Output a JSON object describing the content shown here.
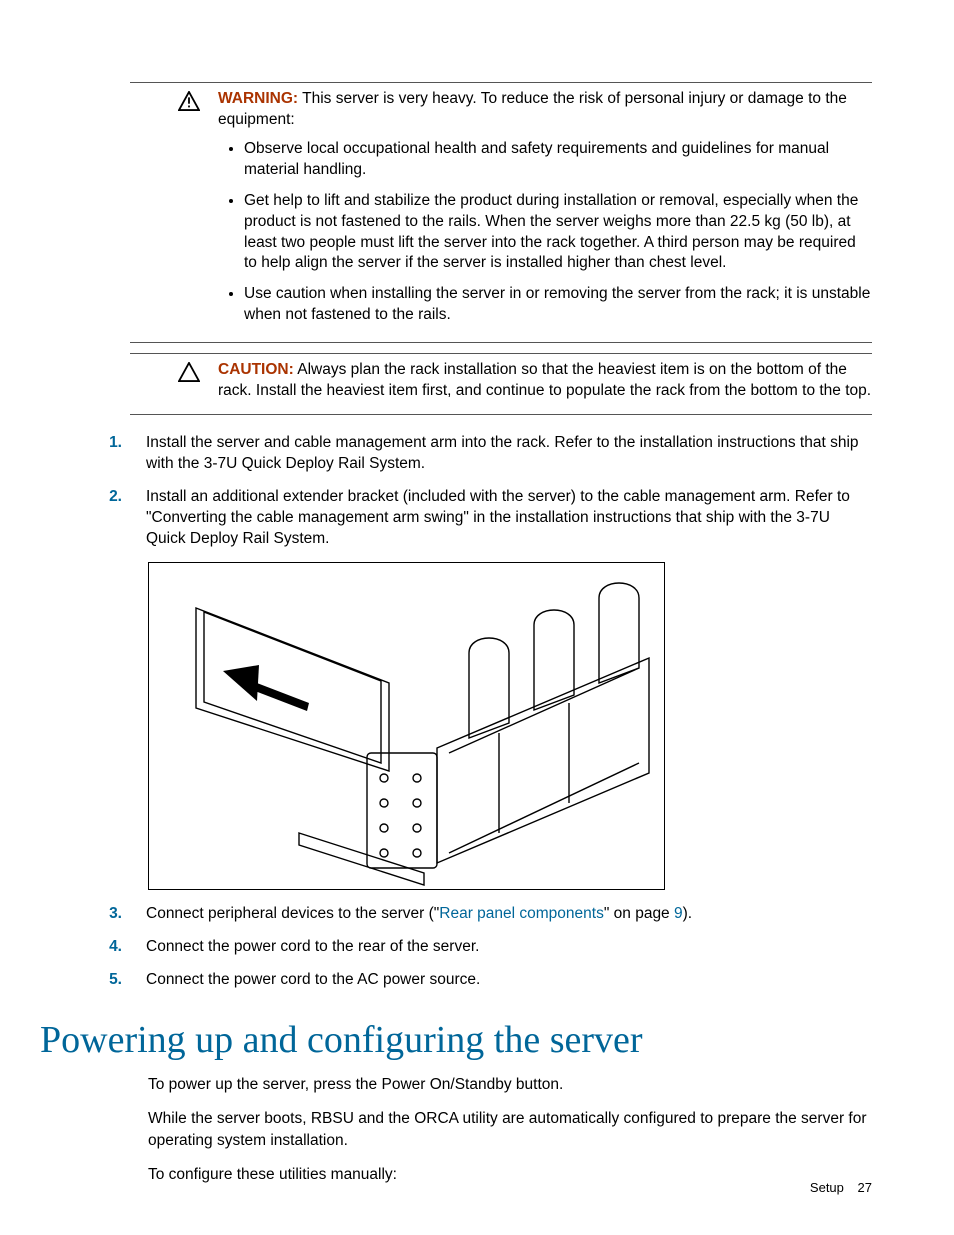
{
  "warning": {
    "label": "WARNING:",
    "intro": "This server is very heavy. To reduce the risk of personal injury or damage to the equipment:",
    "bullets": [
      "Observe local occupational health and safety requirements and guidelines for manual material handling.",
      "Get help to lift and stabilize the product during installation or removal, especially when the product is not fastened to the rails. When the server weighs more than 22.5 kg (50 lb), at least two people must lift the server into the rack together. A third person may be required to help align the server if the server is installed higher than chest level.",
      "Use caution when installing the server in or removing the server from the rack; it is unstable when not fastened to the rails."
    ]
  },
  "caution": {
    "label": "CAUTION:",
    "text": "Always plan the rack installation so that the heaviest item is on the bottom of the rack. Install the heaviest item first, and continue to populate the rack from the bottom to the top."
  },
  "steps_a": {
    "s1": {
      "n": "1.",
      "t": "Install the server and cable management arm into the rack. Refer to the installation instructions that ship with the 3-7U Quick Deploy Rail System."
    },
    "s2": {
      "n": "2.",
      "t": "Install an additional extender bracket (included with the server) to the cable management arm. Refer to \"Converting the cable management arm swing\" in the installation instructions that ship with the 3-7U Quick Deploy Rail System."
    }
  },
  "steps_b": {
    "s3": {
      "n": "3.",
      "pre": "Connect peripheral devices to the server (\"",
      "link1": "Rear panel components",
      "mid": "\" on page ",
      "link2": "9",
      "post": ")."
    },
    "s4": {
      "n": "4.",
      "t": "Connect the power cord to the rear of the server."
    },
    "s5": {
      "n": "5.",
      "t": "Connect the power cord to the AC power source."
    }
  },
  "section_title": "Powering up and configuring the server",
  "body": {
    "p1": "To power up the server, press the Power On/Standby button.",
    "p2": "While the server boots, RBSU and the ORCA utility are automatically configured to prepare the server for operating system installation.",
    "p3": "To configure these utilities manually:"
  },
  "footer": {
    "section": "Setup",
    "page": "27"
  }
}
